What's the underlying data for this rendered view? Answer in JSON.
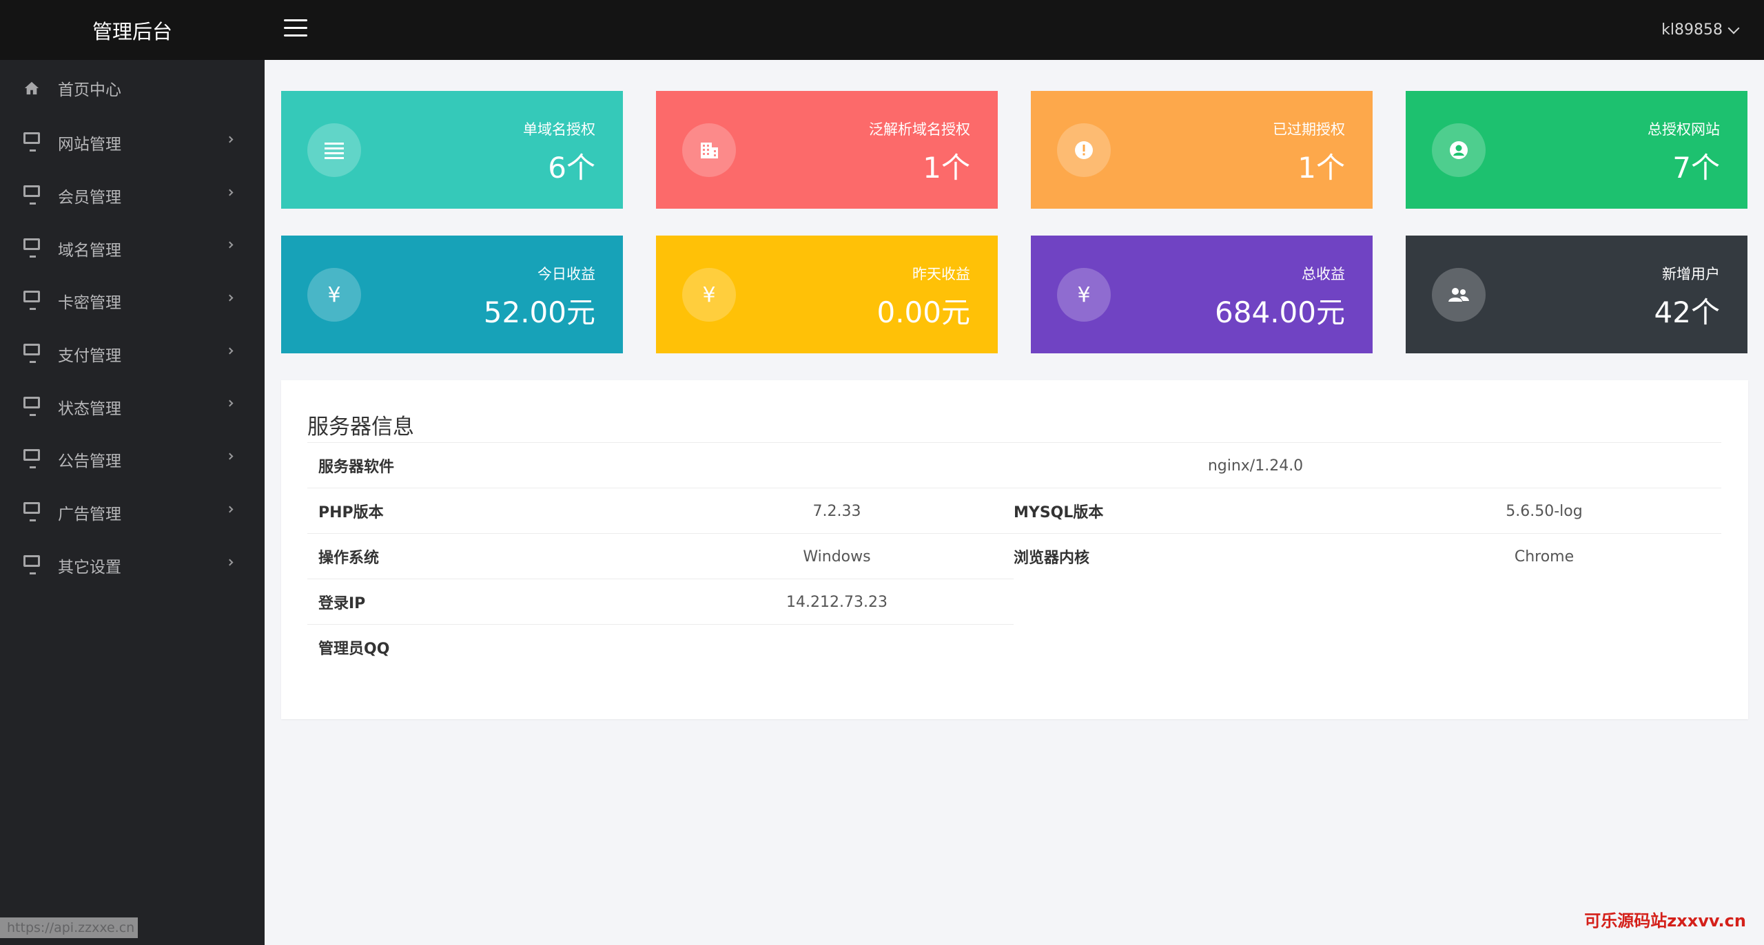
{
  "header": {
    "brand": "管理后台",
    "username": "kl89858"
  },
  "sidebar": {
    "items": [
      {
        "label": "首页中心",
        "icon": "home-icon"
      },
      {
        "label": "网站管理",
        "icon": "monitor-icon"
      },
      {
        "label": "会员管理",
        "icon": "monitor-icon"
      },
      {
        "label": "域名管理",
        "icon": "monitor-icon"
      },
      {
        "label": "卡密管理",
        "icon": "monitor-icon"
      },
      {
        "label": "支付管理",
        "icon": "monitor-icon"
      },
      {
        "label": "状态管理",
        "icon": "monitor-icon"
      },
      {
        "label": "公告管理",
        "icon": "monitor-icon"
      },
      {
        "label": "广告管理",
        "icon": "monitor-icon"
      },
      {
        "label": "其它设置",
        "icon": "monitor-icon"
      }
    ],
    "status_url": "https://api.zzxxe.cn"
  },
  "stats": [
    {
      "label": "单域名授权",
      "value": "6个",
      "color": "#35c9b9",
      "icon": "list-icon"
    },
    {
      "label": "泛解析域名授权",
      "value": "1个",
      "color": "#fc6a6a",
      "icon": "building-icon"
    },
    {
      "label": "已过期授权",
      "value": "1个",
      "color": "#fda84b",
      "icon": "alert-icon"
    },
    {
      "label": "总授权网站",
      "value": "7个",
      "color": "#1dc16f",
      "icon": "user-circle-icon"
    },
    {
      "label": "今日收益",
      "value": "52.00元",
      "color": "#17a2b8",
      "icon": "yen-icon"
    },
    {
      "label": "昨天收益",
      "value": "0.00元",
      "color": "#ffc107",
      "icon": "yen-icon"
    },
    {
      "label": "总收益",
      "value": "684.00元",
      "color": "#7043c3",
      "icon": "yen-icon"
    },
    {
      "label": "新增用户",
      "value": "42个",
      "color": "#343a40",
      "icon": "users-icon"
    }
  ],
  "server": {
    "title": "服务器信息",
    "software_label": "服务器软件",
    "software_value": "nginx/1.24.0",
    "php_label": "PHP版本",
    "php_value": "7.2.33",
    "mysql_label": "MYSQL版本",
    "mysql_value": "5.6.50-log",
    "os_label": "操作系统",
    "os_value": "Windows",
    "browser_label": "浏览器内核",
    "browser_value": "Chrome",
    "ip_label": "登录IP",
    "ip_value": "14.212.73.23",
    "qq_label": "管理员QQ"
  },
  "watermark": "可乐源码站zxxvv.cn"
}
